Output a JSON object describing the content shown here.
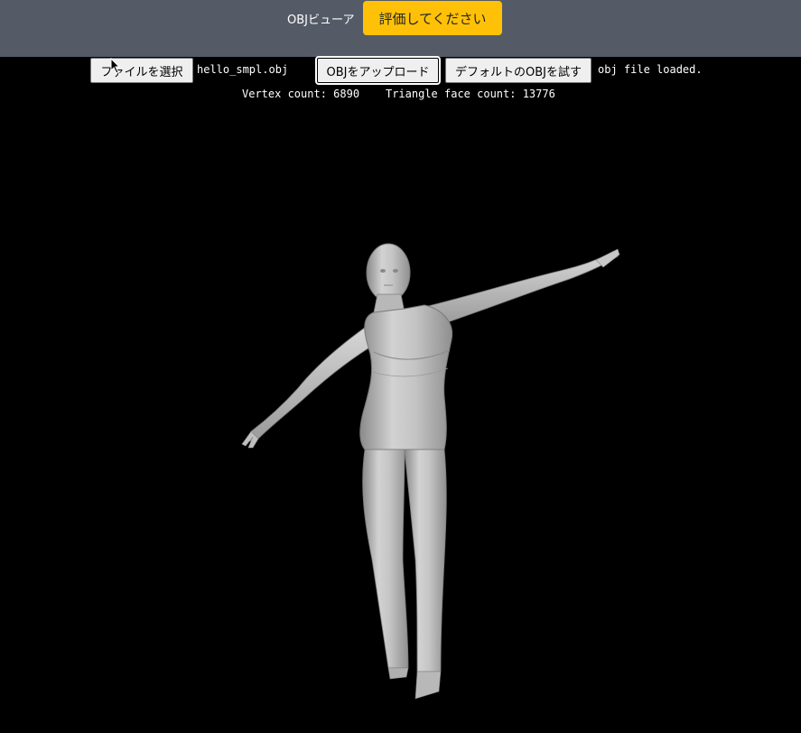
{
  "header": {
    "app_title": "OBJビューア",
    "rate_button_label": "評価してください",
    "background_color": "#545b66",
    "accent_color": "#ffc107"
  },
  "toolbar": {
    "choose_file_label": "ファイルを選択",
    "selected_file_name": "hello_smpl.obj",
    "upload_label": "OBJをアップロード",
    "default_obj_label": "デフォルトのOBJを試す",
    "status_text": "obj file loaded."
  },
  "stats": {
    "vertex_label": "Vertex count:",
    "vertex_count": "6890",
    "face_label": "Triangle face count:",
    "face_count": "13776"
  },
  "viewer": {
    "background_color": "#000000",
    "model_color": "#bdbdbd",
    "model_icon": "human-body-mesh"
  }
}
